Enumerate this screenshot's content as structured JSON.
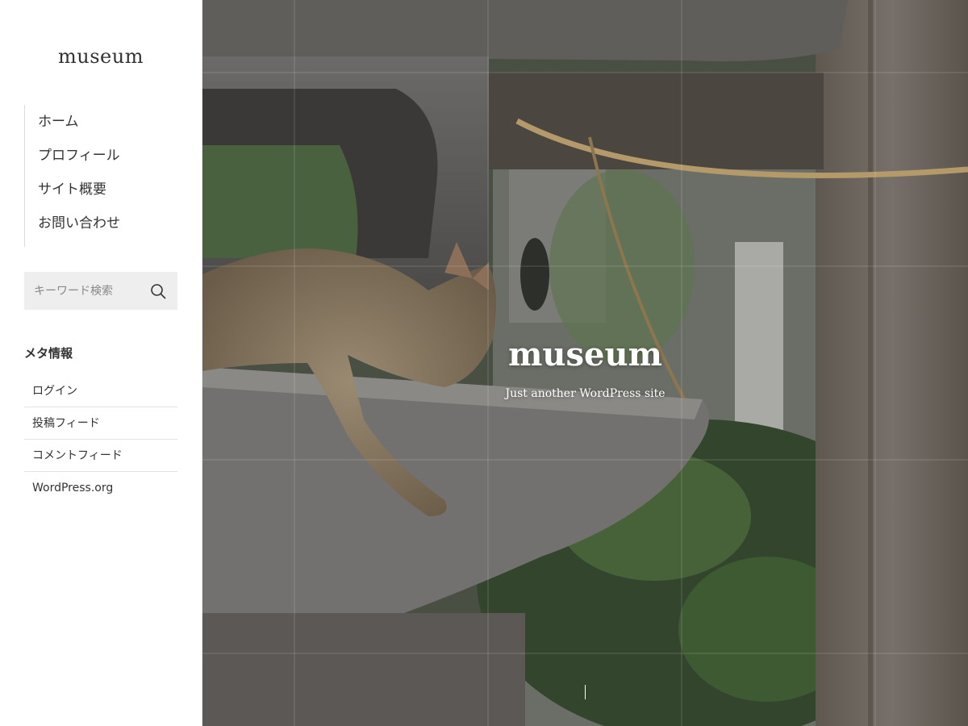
{
  "site": {
    "title": "museum"
  },
  "nav": {
    "items": [
      {
        "label": "ホーム"
      },
      {
        "label": "プロフィール"
      },
      {
        "label": "サイト概要"
      },
      {
        "label": "お問い合わせ"
      }
    ]
  },
  "search": {
    "placeholder": "キーワード検索",
    "icon": "search-icon"
  },
  "meta": {
    "heading": "メタ情報",
    "links": [
      {
        "label": "ログイン"
      },
      {
        "label": "投稿フィード"
      },
      {
        "label": "コメントフィード"
      },
      {
        "label": "WordPress.org"
      }
    ]
  },
  "hero": {
    "title": "museum",
    "tagline": "Just another WordPress site"
  },
  "colors": {
    "accent": "#333333",
    "sidebar_bg": "#ffffff",
    "search_bg": "#eeeeee"
  }
}
